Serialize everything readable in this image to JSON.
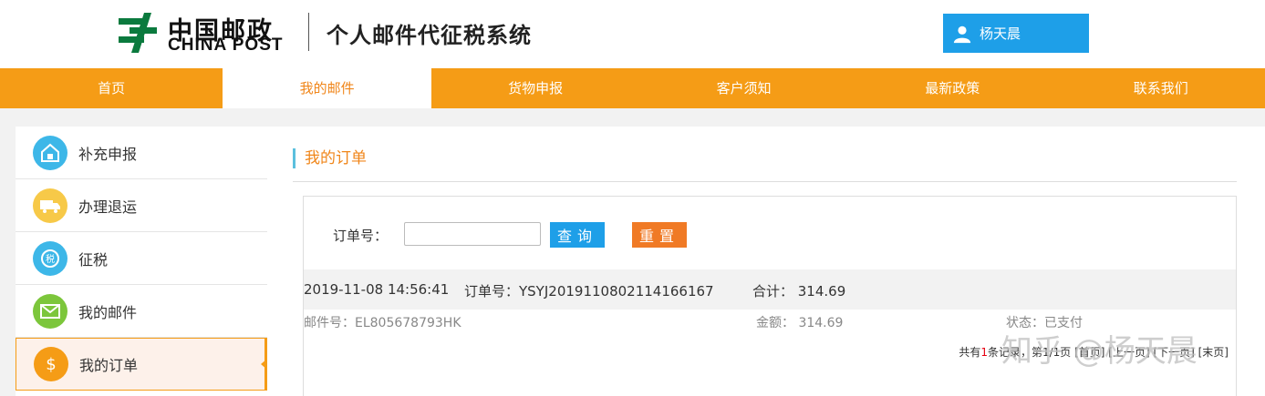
{
  "header": {
    "logo_cn": "中国邮政",
    "logo_en": "CHINA POST",
    "system_title": "个人邮件代征税系统",
    "user_name": "杨天晨"
  },
  "nav": [
    "首页",
    "我的邮件",
    "货物申报",
    "客户须知",
    "最新政策",
    "联系我们"
  ],
  "nav_active_index": 1,
  "sidebar": [
    {
      "label": "补充申报",
      "icon": "house-icon",
      "color": "#3db7e8"
    },
    {
      "label": "办理退运",
      "icon": "truck-icon",
      "color": "#f7c948"
    },
    {
      "label": "征税",
      "icon": "tax-icon",
      "color": "#3db7e8"
    },
    {
      "label": "我的邮件",
      "icon": "mail-icon",
      "color": "#7cc63b"
    },
    {
      "label": "我的订单",
      "icon": "dollar-icon",
      "color": "#f59c16"
    }
  ],
  "main": {
    "section_title": "我的订单",
    "search_label": "订单号：",
    "search_value": "",
    "query_button": "查询",
    "reset_button": "重置",
    "order": {
      "datetime": "2019-11-08 14:56:41",
      "order_no": "订单号：YSYJ2019110802114166167",
      "total": "合计：  314.69"
    },
    "detail": {
      "mail_no": "邮件号：EL805678793HK",
      "amount": "金额：  314.69",
      "status": "状态：已支付"
    },
    "pager": {
      "prefix": "共有",
      "count": "1",
      "suffix": "条记录，第1/1页 [首页] [上一页] [下一页] [末页]"
    }
  },
  "watermark": "知乎 @杨天晨",
  "colors": {
    "nav_bg": "#f59c16",
    "accent_blue": "#1e9fe8",
    "reset_orange": "#f07a25",
    "title_orange": "#f0861a"
  }
}
